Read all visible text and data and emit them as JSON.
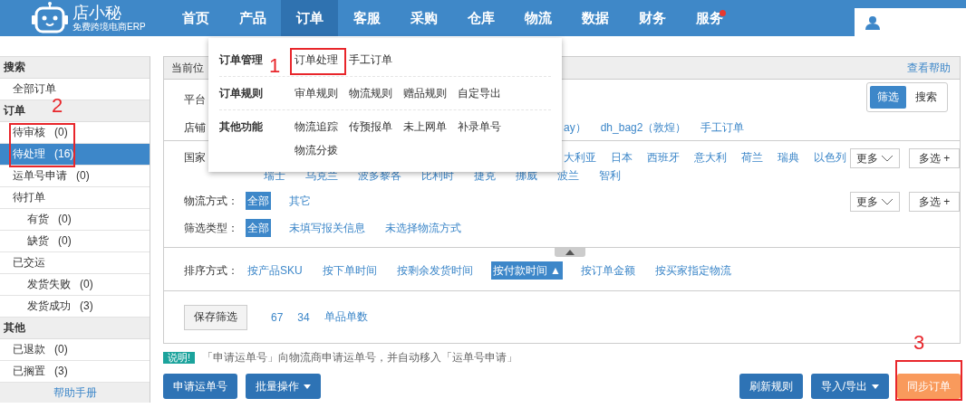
{
  "logo": {
    "name": "店小秘",
    "tagline": "免费跨境电商ERP"
  },
  "nav": [
    {
      "label": "首页",
      "selected": false,
      "badge": false
    },
    {
      "label": "产品",
      "selected": false,
      "badge": false
    },
    {
      "label": "订单",
      "selected": true,
      "badge": false
    },
    {
      "label": "客服",
      "selected": false,
      "badge": false
    },
    {
      "label": "采购",
      "selected": false,
      "badge": false
    },
    {
      "label": "仓库",
      "selected": false,
      "badge": false
    },
    {
      "label": "物流",
      "selected": false,
      "badge": false
    },
    {
      "label": "数据",
      "selected": false,
      "badge": false
    },
    {
      "label": "财务",
      "selected": false,
      "badge": false
    },
    {
      "label": "服务",
      "selected": false,
      "badge": true
    }
  ],
  "sidebar": {
    "groups": [
      {
        "title": "搜索",
        "items": [
          {
            "label": "全部订单",
            "selected": false
          }
        ]
      },
      {
        "title": "订单",
        "items": [
          {
            "label": "待审核",
            "count": "(0)",
            "selected": false
          },
          {
            "label": "待处理",
            "count": "(16)",
            "selected": true
          },
          {
            "label": "运单号申请",
            "count": "(0)",
            "selected": false
          },
          {
            "label": "待打单",
            "selected": false,
            "children": [
              {
                "label": "有货",
                "count": "(0)",
                "selected": false
              },
              {
                "label": "缺货",
                "count": "(0)",
                "selected": false
              }
            ]
          },
          {
            "label": "已交运",
            "selected": false,
            "children": [
              {
                "label": "发货失败",
                "count": "(0)",
                "selected": false
              },
              {
                "label": "发货成功",
                "count": "(3)",
                "selected": false
              }
            ]
          }
        ]
      },
      {
        "title": "其他",
        "items": [
          {
            "label": "已退款",
            "count": "(0)",
            "selected": false
          },
          {
            "label": "已搁置",
            "count": "(3)",
            "selected": false
          }
        ]
      }
    ],
    "footer": "帮助手册"
  },
  "breadcrumb": "当前位",
  "help_link": "查看帮助",
  "view_toggle": [
    {
      "label": "筛选",
      "selected": true
    },
    {
      "label": "搜索",
      "selected": false
    }
  ],
  "filters": [
    {
      "label": "平台"
    },
    {
      "label": "店铺",
      "lines": [
        [
          {
            "label": "ay）",
            "selected": false
          },
          {
            "label": "dh_bag2（敦煌）",
            "selected": false
          },
          {
            "label": "手工订单",
            "selected": false
          }
        ]
      ]
    },
    {
      "label": "国家",
      "more": "更多",
      "multi": "多选 +",
      "lines": [
        [
          {
            "label": "大利亚",
            "selected": false
          },
          {
            "label": "日本",
            "selected": false
          },
          {
            "label": "西班牙",
            "selected": false
          },
          {
            "label": "意大利",
            "selected": false
          },
          {
            "label": "荷兰",
            "selected": false
          },
          {
            "label": "瑞典",
            "selected": false
          },
          {
            "label": "以色列",
            "selected": false
          }
        ],
        [
          {
            "label": "瑞士",
            "selected": false
          },
          {
            "label": "乌克兰",
            "selected": false
          },
          {
            "label": "波多黎各",
            "selected": false
          },
          {
            "label": "比利时",
            "selected": false
          },
          {
            "label": "捷克",
            "selected": false
          },
          {
            "label": "挪威",
            "selected": false
          },
          {
            "label": "波兰",
            "selected": false
          },
          {
            "label": "智利",
            "selected": false
          }
        ]
      ]
    },
    {
      "label": "物流方式：",
      "more": "更多",
      "multi": "多选 +",
      "lines": [
        [
          {
            "label": "全部",
            "selected": true
          },
          {
            "label": "其它",
            "selected": false
          }
        ]
      ]
    },
    {
      "label": "筛选类型：",
      "lines": [
        [
          {
            "label": "全部",
            "selected": true
          },
          {
            "label": "未填写报关信息",
            "selected": false
          },
          {
            "label": "未选择物流方式",
            "selected": false
          }
        ]
      ]
    }
  ],
  "sort": {
    "label": "排序方式：",
    "options": [
      {
        "label": "按产品SKU",
        "selected": false
      },
      {
        "label": "按下单时间",
        "selected": false
      },
      {
        "label": "按剩余发货时间",
        "selected": false
      },
      {
        "label": "按付款时间",
        "arrow": "▲",
        "selected": true
      },
      {
        "label": "按订单金额",
        "selected": false
      },
      {
        "label": "按买家指定物流",
        "selected": false
      }
    ]
  },
  "saved": {
    "button": "保存筛选",
    "links": [
      "67",
      "34",
      "单品单数"
    ]
  },
  "note": {
    "badge": "说明!",
    "text": "「申请运单号」向物流商申请运单号，并自动移入「运单号申请」"
  },
  "actions_left": [
    {
      "label": "申请运单号",
      "kind": "primary",
      "dropdown": false
    },
    {
      "label": "批量操作",
      "kind": "primary",
      "dropdown": true
    }
  ],
  "actions_right": [
    {
      "label": "刷新规则",
      "kind": "primary",
      "dropdown": false
    },
    {
      "label": "导入/导出",
      "kind": "primary",
      "dropdown": true
    },
    {
      "label": "同步订单",
      "kind": "warning",
      "dropdown": false
    }
  ],
  "order_menu": [
    {
      "title": "订单管理",
      "items": [
        "订单处理",
        "手工订单"
      ]
    },
    {
      "title": "订单规则",
      "items": [
        "审单规则",
        "物流规则",
        "赠品规则",
        "自定导出"
      ]
    },
    {
      "title": "其他功能",
      "items": [
        "物流追踪",
        "传预报单",
        "未上网单",
        "补录单号",
        "物流分拨"
      ]
    }
  ],
  "annotations": [
    "1",
    "2",
    "3"
  ]
}
